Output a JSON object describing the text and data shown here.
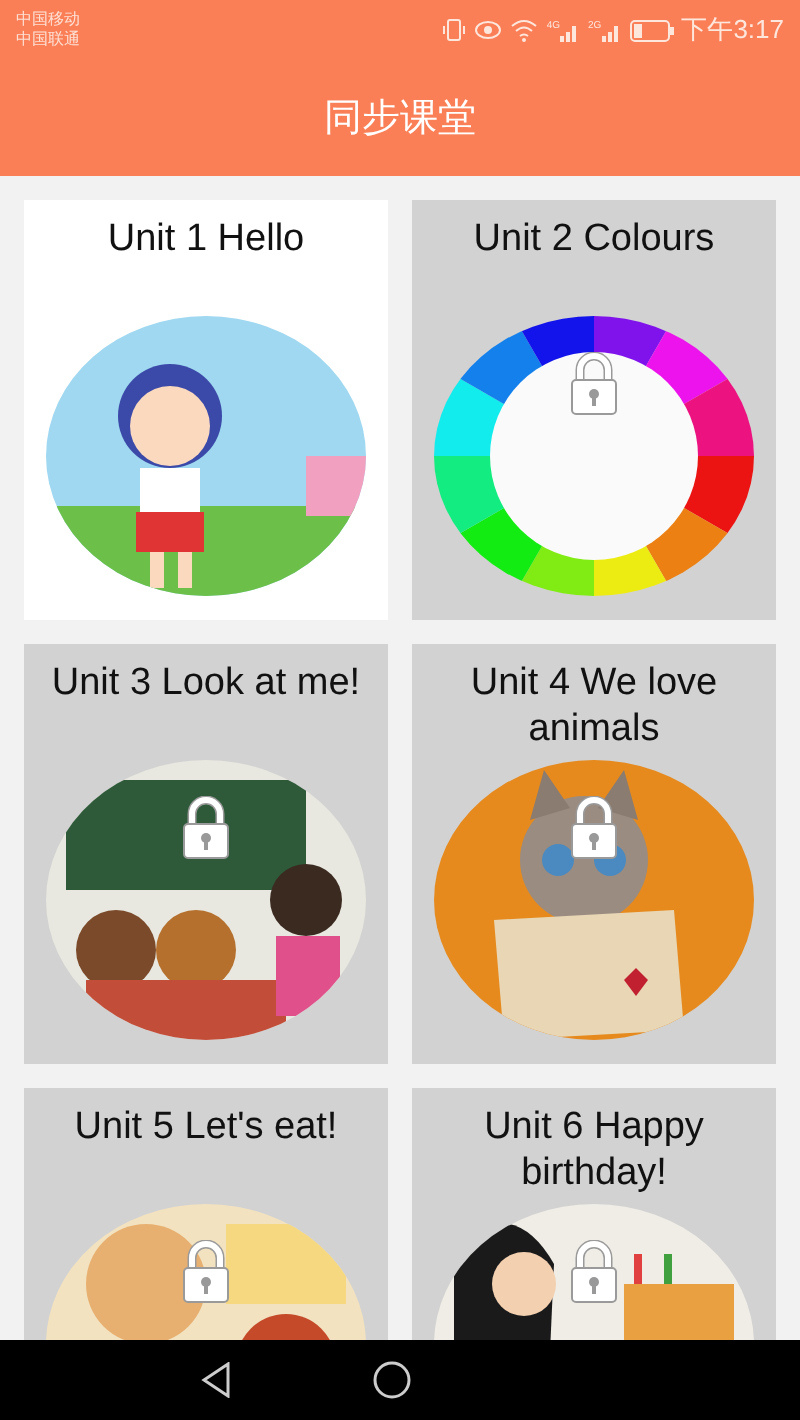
{
  "status_bar": {
    "carriers": [
      "中国移动",
      "中国联通"
    ],
    "signals": [
      "4G",
      "2G"
    ],
    "time": "下午3:17"
  },
  "header": {
    "title": "同步课堂"
  },
  "units": [
    {
      "title": "Unit 1 Hello",
      "locked": false
    },
    {
      "title": "Unit 2 Colours",
      "locked": true
    },
    {
      "title": "Unit 3 Look at me!",
      "locked": true
    },
    {
      "title": "Unit 4 We love animals",
      "locked": true
    },
    {
      "title": "Unit 5 Let's eat!",
      "locked": true
    },
    {
      "title": "Unit 6 Happy birthday!",
      "locked": true
    }
  ]
}
